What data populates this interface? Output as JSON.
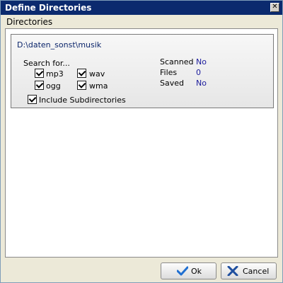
{
  "window": {
    "title": "Define Directories"
  },
  "menu": {
    "directories_label": "Directories"
  },
  "panel": {
    "path": "D:\\daten_sonst\\musik",
    "search_label": "Search for...",
    "checkboxes": [
      {
        "label": "mp3",
        "checked": true
      },
      {
        "label": "wav",
        "checked": true
      },
      {
        "label": "ogg",
        "checked": true
      },
      {
        "label": "wma",
        "checked": true
      }
    ],
    "include_subdirs": {
      "label": "Include Subdirectories",
      "checked": true
    },
    "info": [
      {
        "key": "Scanned",
        "value": "No"
      },
      {
        "key": "Files",
        "value": "0"
      },
      {
        "key": "Saved",
        "value": "No"
      }
    ]
  },
  "buttons": {
    "ok_label": "Ok",
    "cancel_label": "Cancel"
  },
  "colors": {
    "title_bar": "#0b2a6e",
    "value_text": "#1a1a9c",
    "path_text": "#0a246a",
    "check_icon": "#1f6fd1",
    "cancel_icon": "#1f4f9f"
  }
}
